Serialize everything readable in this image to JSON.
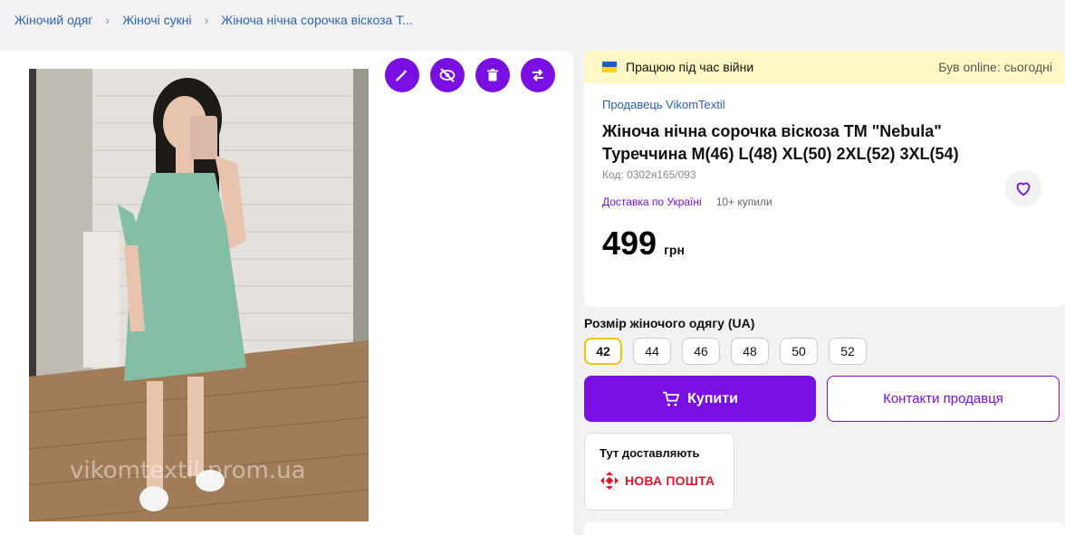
{
  "breadcrumb": {
    "items": [
      "Жіночий одяг",
      "Жіночі сукні",
      "Жіноча нічна сорочка віскоза Т..."
    ],
    "separator": "›"
  },
  "photo": {
    "watermark": "vikomtextil.prom.ua"
  },
  "tools": {
    "icons": [
      "pencil-icon",
      "eye-off-icon",
      "trash-icon",
      "swap-arrows-icon"
    ]
  },
  "banner": {
    "war_text": "Працюю під час війни",
    "online_text": "Був online: сьогодні"
  },
  "product": {
    "seller": "Продавець VikomTextil",
    "title_line1": "Жіноча нічна сорочка віскоза ТМ \"Nebula\"",
    "title_line2": "Туреччина M(46) L(48) XL(50) 2XL(52) 3XL(54)",
    "code": "Код: 0302я165/093",
    "delivery": "Доставка по Україні",
    "bought": "10+ купили",
    "price": "499",
    "currency": "грн"
  },
  "sizes": {
    "label": "Розмір жіночого одягу (UA)",
    "options": [
      "42",
      "44",
      "46",
      "48",
      "50",
      "52"
    ],
    "selected": "42"
  },
  "actions": {
    "buy_label": "Купити",
    "contact_label": "Контакти продавця"
  },
  "delivery_card": {
    "title": "Тут доставляють",
    "carrier": "НОВА ПОШТА"
  },
  "colors": {
    "accent": "#7a0fe2",
    "link": "#2b61b9",
    "banner": "#fff8c5",
    "nova_poshta": "#e3172a",
    "selected_size_border": "#f5c400"
  }
}
